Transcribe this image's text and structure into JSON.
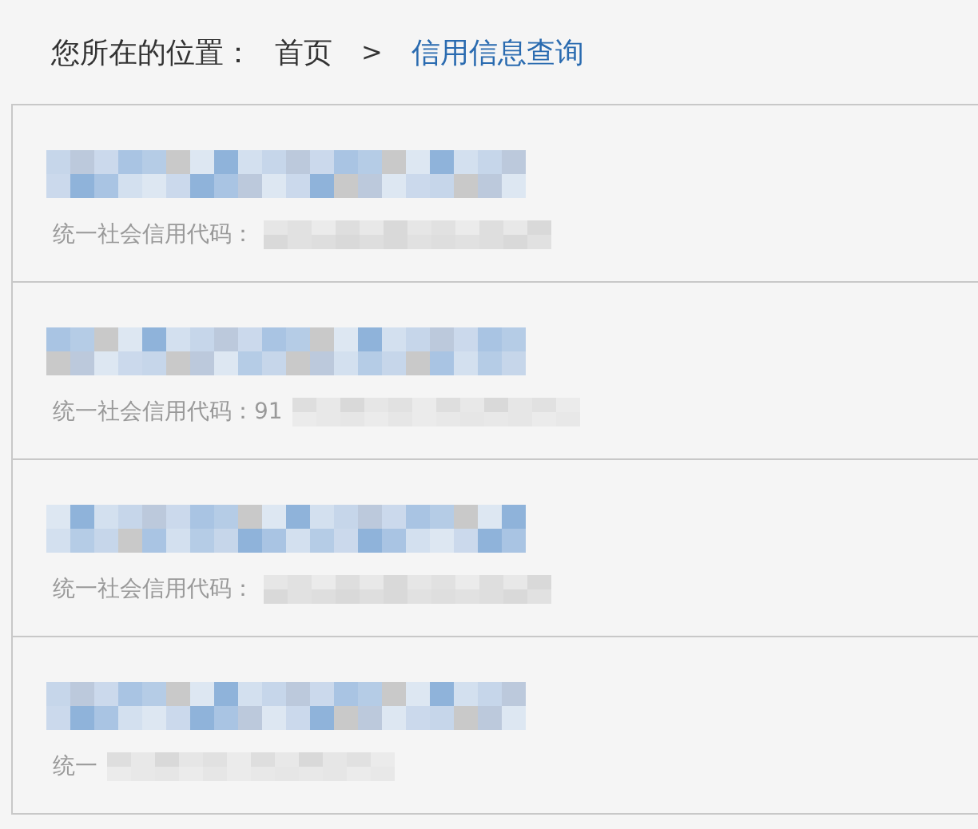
{
  "breadcrumb": {
    "label": "您所在的位置：",
    "items": [
      {
        "text": "首页",
        "current": false
      },
      {
        "text": "信用信息查询",
        "current": true
      }
    ],
    "separator": ">"
  },
  "results": [
    {
      "code_label": "统一社会信用代码："
    },
    {
      "code_label": "统一社会信用代码：91"
    },
    {
      "code_label": "统一社会信用代码："
    },
    {
      "code_label": "统一"
    }
  ]
}
